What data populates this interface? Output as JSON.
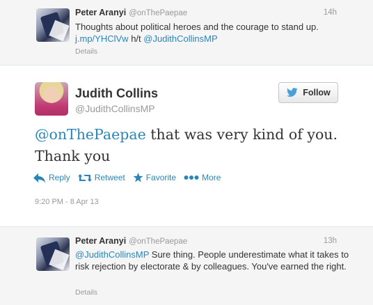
{
  "reply_top": {
    "author_name": "Peter Aranyi",
    "author_handle": "@onThePaepae",
    "time": "14h",
    "text_before": "Thoughts about political heroes and  the courage to stand up. ",
    "link": "j.mp/YHClVw",
    "text_middle": " h/t ",
    "mention": "@JudithCollinsMP",
    "details": "Details"
  },
  "main_tweet": {
    "author_name": "Judith Collins",
    "author_handle": "@JudithCollinsMP",
    "follow_label": "Follow",
    "mention": "@onThePaepae",
    "text": " that was very kind of you. Thank you",
    "actions": {
      "reply": "Reply",
      "retweet": "Retweet",
      "favorite": "Favorite",
      "more": "More"
    },
    "timestamp": "9:20 PM - 8 Apr 13"
  },
  "reply_bottom": {
    "author_name": "Peter Aranyi",
    "author_handle": "@onThePaepae",
    "time": "13h",
    "mention": "@JudithCollinsMP",
    "text": " Sure thing. People underestimate what it takes to risk rejection by electorate & by colleagues. You've earned the right.",
    "details": "Details"
  },
  "colors": {
    "link": "#2a86b7",
    "muted": "#999999",
    "text": "#333333",
    "reply_bg": "#f5f5f5"
  },
  "icons": [
    "bird-icon",
    "reply-icon",
    "retweet-icon",
    "favorite-icon",
    "more-icon"
  ]
}
